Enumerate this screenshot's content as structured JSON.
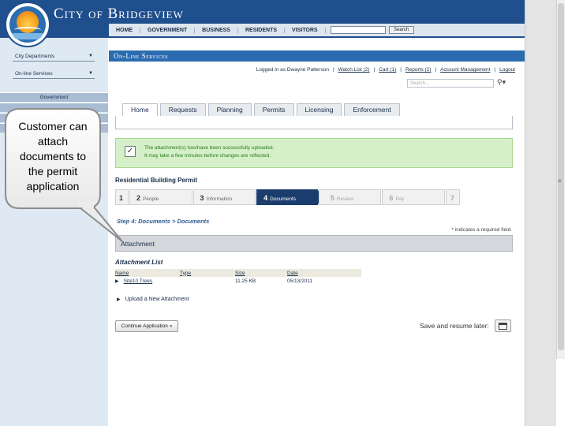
{
  "header": {
    "city_title": "City of Bridgeview",
    "nav": [
      "HOME",
      "GOVERNMENT",
      "BUSINESS",
      "RESIDENTS",
      "VISITORS"
    ],
    "search_button": "Search"
  },
  "sidebar": {
    "select_departments": "City Departments",
    "select_services": "On-line Services",
    "band_label": "Government"
  },
  "callout": {
    "text": "Customer can attach documents to the permit application"
  },
  "services_bar": "On-Line Services",
  "user_links": {
    "logged_in": "Logged in as Dwayne Patterson",
    "watch_list": "Watch List (2)",
    "cart": "Cart (1)",
    "reports": "Reports (2)",
    "account": "Account Management",
    "logout": "Logout"
  },
  "portal_search": {
    "placeholder": "Search..."
  },
  "tabs": [
    "Home",
    "Requests",
    "Planning",
    "Permits",
    "Licensing",
    "Enforcement"
  ],
  "notice": {
    "line1": "The attachment(s) has/have been successfully uploaded.",
    "line2": "It may take a few minutes before changes are reflected."
  },
  "permit_title": "Residential Building Permit",
  "steps": [
    {
      "num": "1",
      "label": ""
    },
    {
      "num": "2",
      "label": "People"
    },
    {
      "num": "3",
      "label": "Information"
    },
    {
      "num": "4",
      "label": "Documents"
    },
    {
      "num": "5",
      "label": "Review"
    },
    {
      "num": "6",
      "label": "Pay"
    },
    {
      "num": "7",
      "label": ""
    }
  ],
  "step_heading": "Step 4: Documents > Documents",
  "required_note": "* indicates a required field.",
  "attachment_bar": "Attachment",
  "attachment_list": {
    "title": "Attachment List",
    "columns": [
      "Name",
      "Type",
      "Size",
      "Date"
    ],
    "rows": [
      {
        "name": "Site10 Trees",
        "type": "",
        "size": "11.25 KB",
        "date": "05/13/2011"
      }
    ]
  },
  "upload_link": "Upload a New Attachment",
  "continue_button": "Continue Application »",
  "save_label": "Save and resume later:",
  "colors": {
    "header_blue": "#1f4f8c",
    "services_blue": "#2b6cb0",
    "active_step": "#1a3d6d",
    "notice_green": "#d5f0c9",
    "notice_text": "#2a7a1a"
  }
}
